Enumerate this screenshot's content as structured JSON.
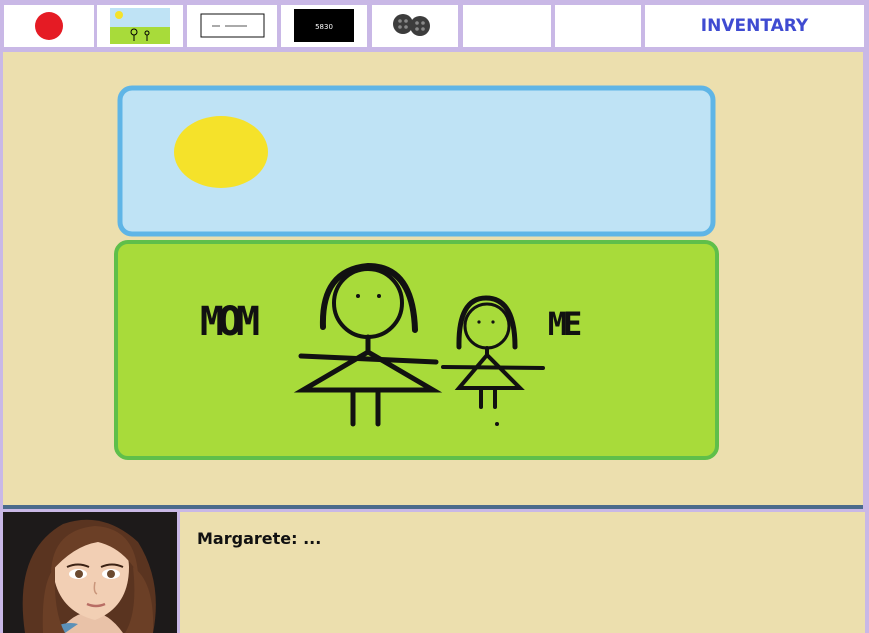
{
  "inventory_bar": {
    "slots": [
      {
        "item": "red-dot",
        "color": "#e51b24"
      },
      {
        "item": "drawing-thumbnail"
      },
      {
        "item": "note-card"
      },
      {
        "item": "black-card",
        "text": "5830"
      },
      {
        "item": "buttons"
      },
      {
        "item": "empty"
      },
      {
        "item": "empty"
      }
    ],
    "inventory_label": "INVENTARY",
    "label_color": "#3f4bd1"
  },
  "scene": {
    "drawing": {
      "labels": {
        "mom": "MOM",
        "me": "ME"
      },
      "sky_color": "#bfe3f5",
      "grass_color": "#a8db3a",
      "sun_color": "#f5e22a"
    }
  },
  "dialog": {
    "speaker": "Margarete",
    "text": "Margarete: ..."
  }
}
